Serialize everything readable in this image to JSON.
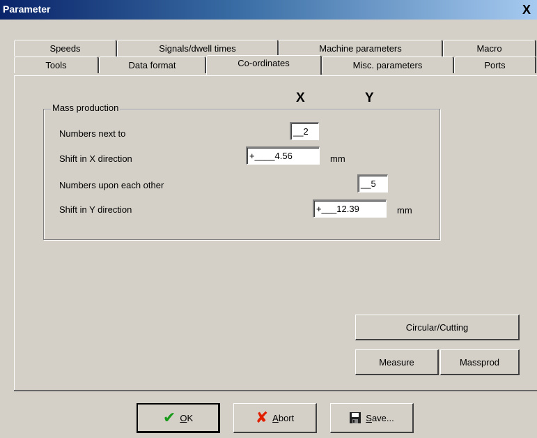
{
  "window": {
    "title": "Parameter",
    "close_glyph": "X"
  },
  "tabs_back": [
    "Speeds",
    "Signals/dwell times",
    "Machine parameters",
    "Macro"
  ],
  "tabs_front": [
    "Tools",
    "Data format",
    "Co-ordinates",
    "Misc. parameters",
    "Ports"
  ],
  "active_tab": "Co-ordinates",
  "columns": {
    "x": "X",
    "y": "Y"
  },
  "mass_production": {
    "legend": "Mass production",
    "numbers_next_to": {
      "label": "Numbers next to",
      "value": "__2"
    },
    "shift_x": {
      "label": "Shift in X direction",
      "value": "+____4.56",
      "unit": "mm"
    },
    "numbers_upon": {
      "label": "Numbers upon each other",
      "value": "__5"
    },
    "shift_y": {
      "label": "Shift in Y direction",
      "value": "+___12.39",
      "unit": "mm"
    }
  },
  "buttons": {
    "circular": "Circular/Cutting",
    "measure": "Measure",
    "massprod": "Massprod",
    "ok": {
      "mnemonic": "O",
      "rest": "K"
    },
    "abort": {
      "mnemonic": "A",
      "rest": "bort"
    },
    "save": {
      "mnemonic": "S",
      "rest": "ave..."
    }
  },
  "icons": {
    "ok": "check-icon",
    "abort": "cross-icon",
    "save": "floppy-disk-icon"
  },
  "colors": {
    "titlebar_start": "#0a246a",
    "titlebar_end": "#a6caf0",
    "face": "#d4d0c8",
    "ok_icon": "#1a9a1a",
    "abort_icon": "#e02000"
  }
}
